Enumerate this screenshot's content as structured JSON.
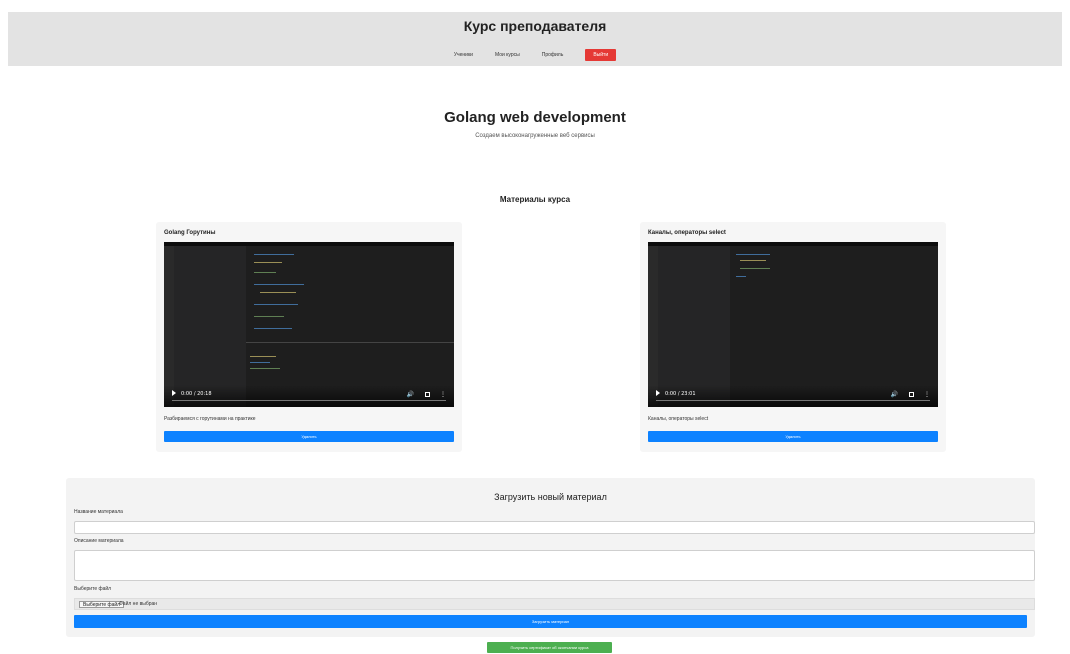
{
  "header": {
    "title": "Курс преподавателя",
    "nav": {
      "students": "Ученики",
      "my_courses": "Мои курсы",
      "profile": "Профиль",
      "logout": "Выйти"
    }
  },
  "course": {
    "title": "Golang web development",
    "description": "Создаем высоконагруженные веб сервисы"
  },
  "materials": {
    "heading": "Материалы курса",
    "items": [
      {
        "title": "Golang Горутины",
        "time": "0:00 / 20:18",
        "description": "Разбираемся с горутинами на практике",
        "delete_label": "Удалить"
      },
      {
        "title": "Каналы, операторы select",
        "time": "0:00 / 23:01",
        "description": "Каналы, операторы select",
        "delete_label": "Удалить"
      }
    ]
  },
  "upload": {
    "title": "Загрузить новый материал",
    "name_label": "Название материала",
    "description_label": "Описание материала",
    "file_label": "Выберите файл",
    "file_button": "Выберите файл",
    "file_status": "Файл не выбран",
    "submit_label": "Загрузить материал"
  },
  "certificate_button": "Получить сертификат об окончании курса",
  "colors": {
    "accent": "#0d82ff",
    "danger": "#e53935",
    "success": "#4caf50",
    "header_bg": "#e3e3e3"
  },
  "icons": [
    "play-icon",
    "volume-icon",
    "fullscreen-icon",
    "more-icon"
  ]
}
